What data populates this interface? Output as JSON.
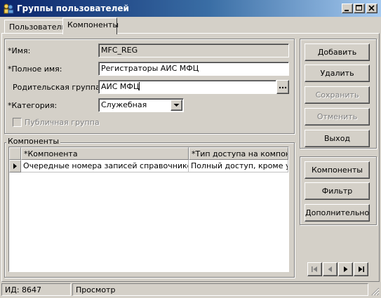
{
  "window": {
    "title": "Группы пользователей"
  },
  "tabs": [
    {
      "label": "Пользователи",
      "active": false
    },
    {
      "label": "Компоненты",
      "active": true
    }
  ],
  "form": {
    "name_label": "*Имя:",
    "name_value": "MFC_REG",
    "fullname_label": "*Полное имя:",
    "fullname_value": "Регистраторы АИС МФЦ",
    "parent_label": "Родительская группа:",
    "parent_value": "АИС МФЦ",
    "category_label": "*Категория:",
    "category_value": "Служебная",
    "public_label": "Публичная группа",
    "public_checked": false
  },
  "components": {
    "group_label": "Компоненты",
    "columns": [
      "*Компонента",
      "*Тип доступа на компон..."
    ],
    "rows": [
      [
        "Очередные номера записей справочников",
        "Полный доступ, кроме у..."
      ]
    ]
  },
  "buttons": {
    "add": "Добавить",
    "delete": "Удалить",
    "save": "Сохранить",
    "cancel": "Отменить",
    "exit": "Выход",
    "components": "Компоненты",
    "filter": "Фильтр",
    "extra": "Дополнительно"
  },
  "status": {
    "id": "ИД: 8647",
    "mode": "Просмотр"
  },
  "icons": {
    "app": "users-group-icon",
    "ellipsis": "ellipsis-icon",
    "dropdown": "chevron-down-icon"
  }
}
